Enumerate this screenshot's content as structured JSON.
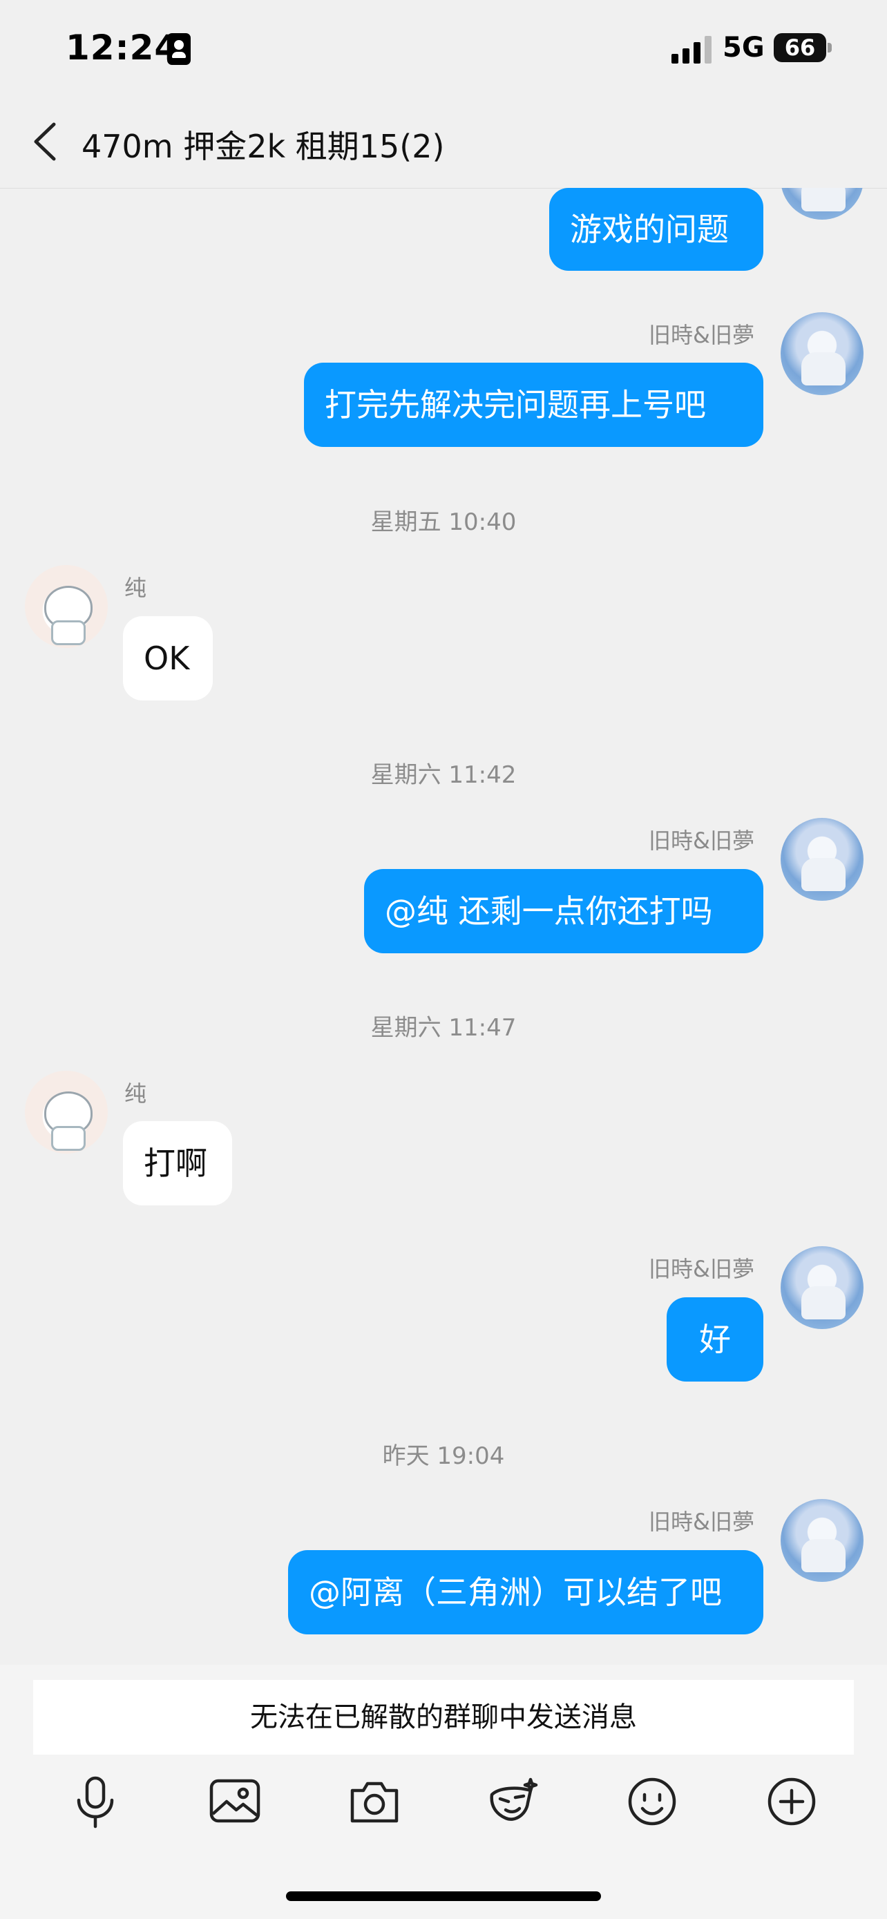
{
  "status_bar": {
    "time": "12:24",
    "network": "5G",
    "battery": "66"
  },
  "header": {
    "title": "470m 押金2k 租期15(2)"
  },
  "messages": {
    "m1": {
      "text": "游戏的问题"
    },
    "m2": {
      "sender": "旧時&旧夢",
      "text": "打完先解决完问题再上号吧"
    },
    "t1": "星期五 10:40",
    "m3": {
      "sender": "纯",
      "text": "OK"
    },
    "t2": "星期六 11:42",
    "m4": {
      "sender": "旧時&旧夢",
      "text": "@纯 还剩一点你还打吗"
    },
    "t3": "星期六 11:47",
    "m5": {
      "sender": "纯",
      "text": "打啊"
    },
    "m6": {
      "sender": "旧時&旧夢",
      "text": "好"
    },
    "t4": "昨天 19:04",
    "m7": {
      "sender": "旧時&旧夢",
      "text": "@阿离（三角洲）可以结了吧"
    }
  },
  "footer": {
    "disabled_notice": "无法在已解散的群聊中发送消息",
    "toolbar_icons": [
      "microphone-icon",
      "image-icon",
      "camera-icon",
      "sticker-icon",
      "emoji-icon",
      "plus-icon"
    ]
  },
  "colors": {
    "outgoing_bubble": "#0a99ff",
    "incoming_bubble": "#ffffff",
    "background": "#f0f0f0"
  }
}
